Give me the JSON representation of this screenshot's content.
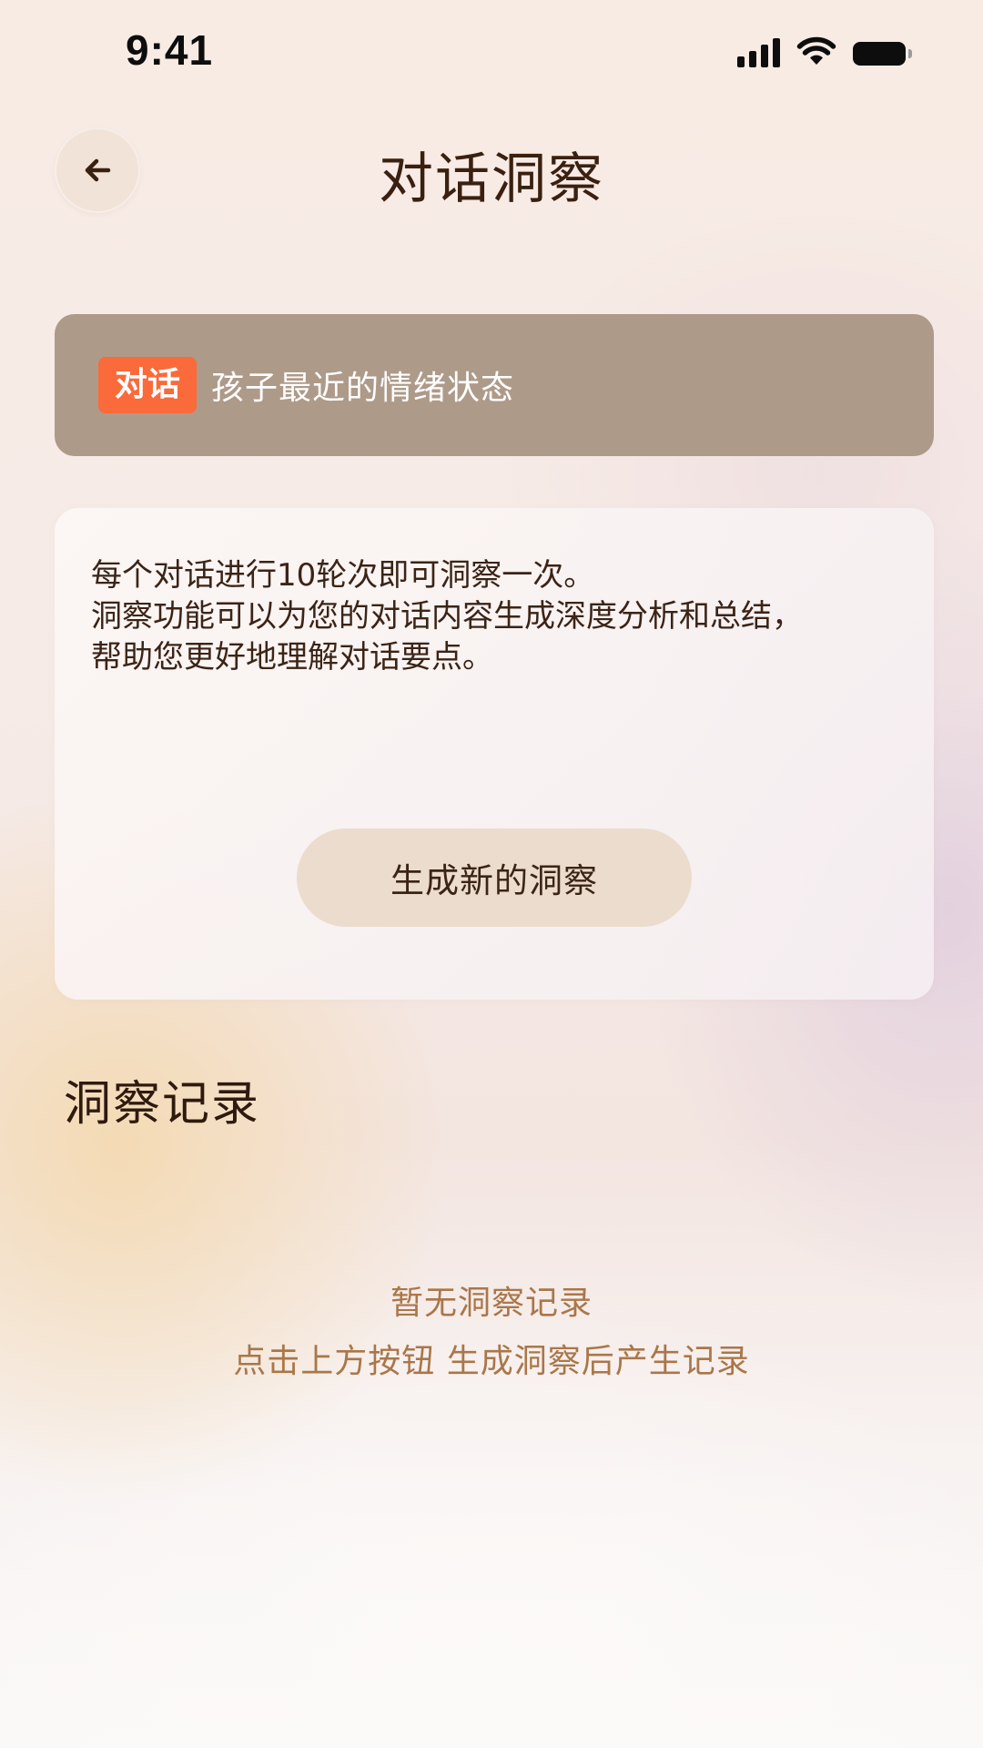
{
  "status_bar": {
    "time": "9:41",
    "icons": [
      "signal-icon",
      "wifi-icon",
      "battery-icon"
    ]
  },
  "header": {
    "back_icon": "arrow-left-icon",
    "title": "对话洞察"
  },
  "topic": {
    "tag": "对话",
    "text": "孩子最近的情绪状态",
    "tag_color": "#fa6a3a",
    "card_color": "#ae9a89"
  },
  "info": {
    "lines": [
      "每个对话进行10轮次即可洞察一次。",
      "洞察功能可以为您的对话内容生成深度分析和总结，",
      "帮助您更好地理解对话要点。"
    ],
    "button_label": "生成新的洞察"
  },
  "records": {
    "title": "洞察记录",
    "empty_title": "暂无洞察记录",
    "empty_hint": "点击上方按钮 生成洞察后产生记录"
  }
}
